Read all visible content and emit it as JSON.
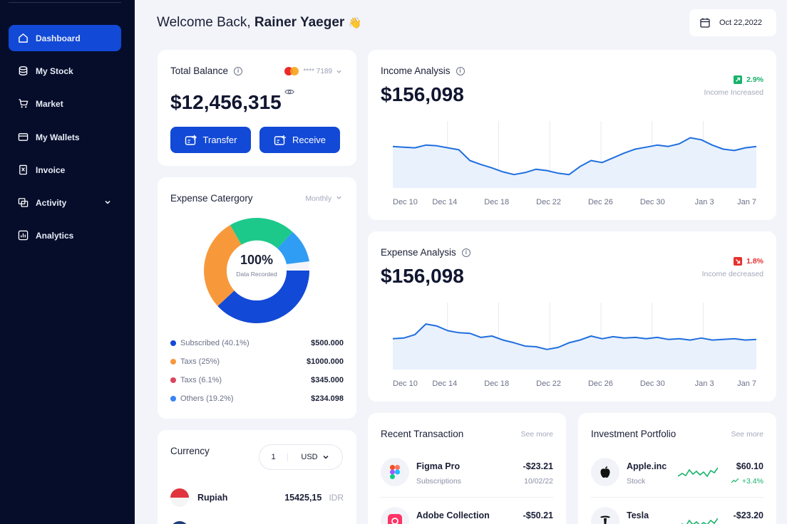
{
  "sidebar": {
    "items": [
      {
        "label": "Dashboard",
        "icon": "home-icon",
        "active": true
      },
      {
        "label": "My Stock",
        "icon": "database-icon"
      },
      {
        "label": "Market",
        "icon": "cart-icon"
      },
      {
        "label": "My Wallets",
        "icon": "wallet-icon"
      },
      {
        "label": "Invoice",
        "icon": "invoice-icon"
      },
      {
        "label": "Activity",
        "icon": "activity-icon",
        "has_dropdown": true
      },
      {
        "label": "Analytics",
        "icon": "analytics-icon"
      }
    ]
  },
  "header": {
    "welcome_prefix": "Welcome Back,",
    "user_name": "Rainer Yaeger",
    "wave_emoji": "👋",
    "date": "Oct 22,2022"
  },
  "total_balance": {
    "title": "Total Balance",
    "card_masked": "**** 7189",
    "amount": "$12,456,315",
    "transfer_label": "Transfer",
    "receive_label": "Receive"
  },
  "expense_category": {
    "title": "Expense Catergory",
    "period": "Monthly",
    "center_pct": "100%",
    "center_label": "Data Recorded",
    "items": [
      {
        "label": "Subscribed (40.1%)",
        "value": "$500.000",
        "color": "#1249d6"
      },
      {
        "label": "Taxs (25%)",
        "value": "$1000.000",
        "color": "#f7993b"
      },
      {
        "label": "Taxs (6.1%)",
        "value": "$345.000",
        "color": "#d9465f"
      },
      {
        "label": "Others (19.2%)",
        "value": "$234.098",
        "color": "#3b82f6"
      }
    ]
  },
  "currency": {
    "title": "Currency",
    "quantity": "1",
    "unit": "USD",
    "rows": [
      {
        "name": "Rupiah",
        "value": "15425,15",
        "code": "IDR"
      }
    ]
  },
  "income_analysis": {
    "title": "Income Analysis",
    "amount": "$156,098",
    "change": "2.9%",
    "change_label": "Income Increased",
    "direction": "up",
    "color_up": "#17b26a"
  },
  "expense_analysis": {
    "title": "Expense Analysis",
    "amount": "$156,098",
    "change": "1.8%",
    "change_label": "Income decreased",
    "direction": "down",
    "color_down": "#e5312f"
  },
  "chart_data": [
    {
      "type": "area",
      "x": [
        "Dec 10",
        "Dec 14",
        "Dec 18",
        "Dec 22",
        "Dec 26",
        "Dec 30",
        "Jan 3",
        "Jan 7"
      ],
      "series": [
        {
          "values": [
            62,
            61,
            60,
            64,
            63,
            60,
            57,
            41,
            35,
            30,
            24,
            20,
            23,
            28,
            26,
            22,
            20,
            32,
            41,
            38,
            45,
            52,
            58,
            61,
            64,
            62,
            66,
            75,
            72,
            64,
            58,
            56,
            60,
            62
          ]
        }
      ]
    },
    {
      "type": "area",
      "x": [
        "Dec 10",
        "Dec 14",
        "Dec 18",
        "Dec 22",
        "Dec 26",
        "Dec 30",
        "Jan 3",
        "Jan 7"
      ],
      "series": [
        {
          "values": [
            46,
            47,
            52,
            68,
            65,
            58,
            55,
            54,
            48,
            50,
            44,
            40,
            35,
            34,
            30,
            33,
            40,
            44,
            50,
            46,
            49,
            47,
            48,
            46,
            48,
            45,
            46,
            44,
            47,
            44,
            45,
            46,
            44,
            45
          ]
        }
      ]
    }
  ],
  "recent_transaction": {
    "title": "Recent Transaction",
    "see_more": "See more",
    "items": [
      {
        "name": "Figma Pro",
        "sub": "Subscriptions",
        "amount": "-$23.21",
        "date": "10/02/22",
        "icon": "figma-icon"
      },
      {
        "name": "Adobe Collection",
        "amount": "-$50.21",
        "icon": "adobe-icon"
      }
    ]
  },
  "investment_portfolio": {
    "title": "Investment Portfolio",
    "see_more": "See more",
    "items": [
      {
        "name": "Apple.inc",
        "sub": "Stock",
        "amount": "$60.10",
        "change": "+3.4%",
        "icon": "apple-icon"
      },
      {
        "name": "Tesla",
        "amount": "-$23.20",
        "icon": "tesla-icon"
      }
    ]
  }
}
